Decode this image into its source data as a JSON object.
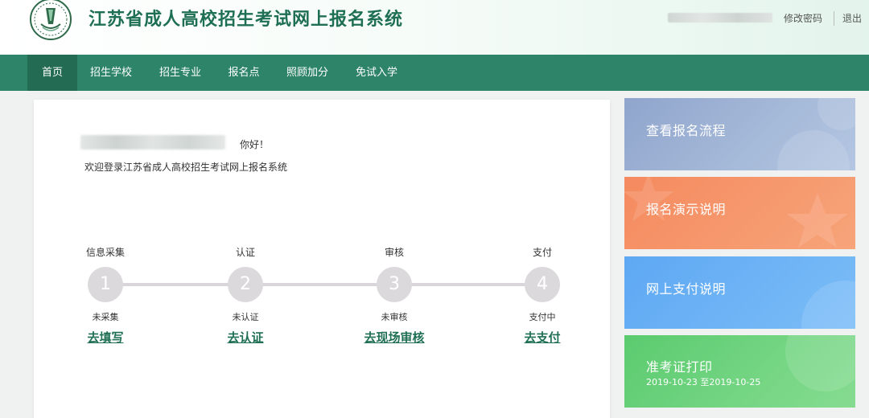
{
  "header": {
    "title": "江苏省成人高校招生考试网上报名系统",
    "change_password": "修改密码",
    "logout": "退出"
  },
  "nav": {
    "items": [
      {
        "label": "首页",
        "active": true
      },
      {
        "label": "招生学校"
      },
      {
        "label": "招生专业"
      },
      {
        "label": "报名点"
      },
      {
        "label": "照顾加分"
      },
      {
        "label": "免试入学"
      }
    ]
  },
  "main": {
    "greeting": "你好！",
    "welcome": "欢迎登录江苏省成人高校招生考试网上报名系统",
    "steps": [
      {
        "title": "信息采集",
        "number": "1",
        "status": "未采集",
        "action": "去填写"
      },
      {
        "title": "认证",
        "number": "2",
        "status": "未认证",
        "action": "去认证"
      },
      {
        "title": "审核",
        "number": "3",
        "status": "未审核",
        "action": "去现场审核"
      },
      {
        "title": "支付",
        "number": "4",
        "status": "支付中",
        "action": "去支付"
      }
    ]
  },
  "side_cards": [
    {
      "label": "查看报名流程",
      "color": "#9ab0d4"
    },
    {
      "label": "报名演示说明",
      "color": "#f69468"
    },
    {
      "label": "网上支付说明",
      "color": "#6cb2f5"
    },
    {
      "label": "准考证打印",
      "sub": "2019-10-23 至2019-10-25",
      "color": "#6fd37e"
    }
  ],
  "colors": {
    "brand_green": "#2e8468",
    "title_green": "#1f6f55"
  }
}
